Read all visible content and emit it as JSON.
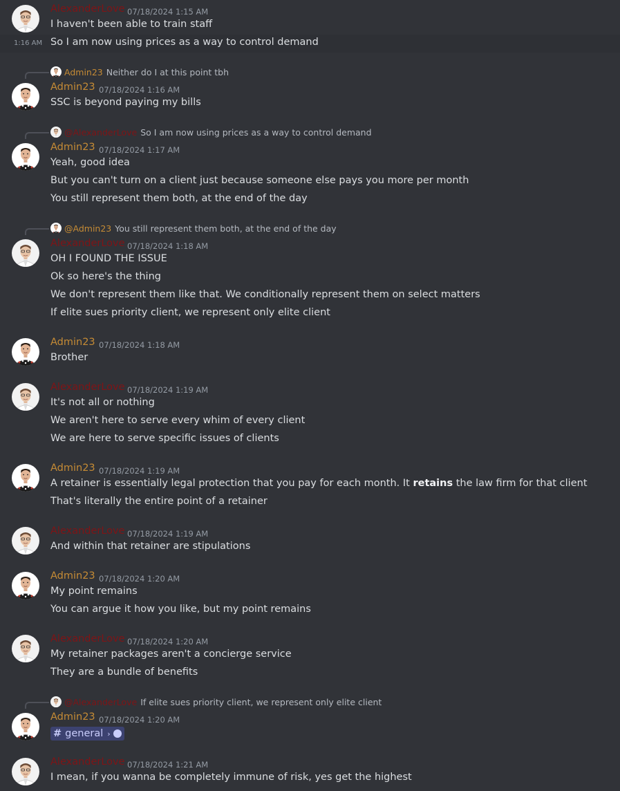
{
  "users": {
    "alex": {
      "name": "AlexanderLove",
      "color": "#7f1416"
    },
    "admin": {
      "name": "Admin23",
      "color": "#c58b35"
    }
  },
  "messages": [
    {
      "author": "AlexanderLove",
      "timestamp": "07/18/2024 1:15 AM",
      "lines": [
        "I haven't been able to train staff"
      ]
    },
    {
      "side_time": "1:16 AM",
      "line": "So I am now using prices as a way to control demand"
    },
    {
      "reply_to": {
        "author": "Admin23",
        "text": "Neither do I at this point tbh"
      },
      "author": "Admin23",
      "timestamp": "07/18/2024 1:16 AM",
      "lines": [
        "SSC is beyond paying my bills"
      ]
    },
    {
      "reply_to": {
        "author": "@AlexanderLove",
        "text": "So I am now using prices as a way to control demand"
      },
      "author": "Admin23",
      "timestamp": "07/18/2024 1:17 AM",
      "lines": [
        "Yeah, good idea",
        "But you can't turn on a client just because someone else pays you more per month",
        "You still represent them both, at the end of the day"
      ]
    },
    {
      "reply_to": {
        "author": "@Admin23",
        "text": "You still represent them both, at the end of the day"
      },
      "author": "AlexanderLove",
      "timestamp": "07/18/2024 1:18 AM",
      "lines": [
        "OH I FOUND THE ISSUE",
        "Ok so here's the thing",
        "We don't represent them like that. We conditionally represent them on select matters",
        "If elite sues priority client, we represent only elite client"
      ]
    },
    {
      "author": "Admin23",
      "timestamp": "07/18/2024 1:18 AM",
      "lines": [
        "Brother"
      ]
    },
    {
      "author": "AlexanderLove",
      "timestamp": "07/18/2024 1:19 AM",
      "lines": [
        "It's not all or nothing",
        "We aren't here to serve every whim of every client",
        "We are here to serve specific issues of clients"
      ]
    },
    {
      "author": "Admin23",
      "timestamp": "07/18/2024 1:19 AM",
      "line1_before": "A retainer is essentially legal protection that you pay for each month. It ",
      "line1_bold": "retains",
      "line1_after": " the law firm for that client",
      "line2": "That's literally the entire point of a retainer"
    },
    {
      "author": "AlexanderLove",
      "timestamp": "07/18/2024 1:19 AM",
      "lines": [
        "And within that retainer are stipulations"
      ]
    },
    {
      "author": "Admin23",
      "timestamp": "07/18/2024 1:20 AM",
      "lines": [
        "My point remains",
        "You can argue it how you like, but my point remains"
      ]
    },
    {
      "author": "AlexanderLove",
      "timestamp": "07/18/2024 1:20 AM",
      "lines": [
        "My retainer packages aren't a concierge service",
        "They are a bundle of benefits"
      ]
    },
    {
      "reply_to": {
        "author": "@AlexanderLove",
        "text": "If elite sues priority client, we represent only elite client"
      },
      "author": "Admin23",
      "timestamp": "07/18/2024 1:20 AM",
      "channel_mention": {
        "hash": "#",
        "name": "general",
        "arrow": "›",
        "icon": "chat-bubble-icon"
      }
    },
    {
      "author": "AlexanderLove",
      "timestamp": "07/18/2024 1:21 AM",
      "lines": [
        "I mean, if you wanna be completely immune of risk, yes get the highest"
      ]
    }
  ]
}
